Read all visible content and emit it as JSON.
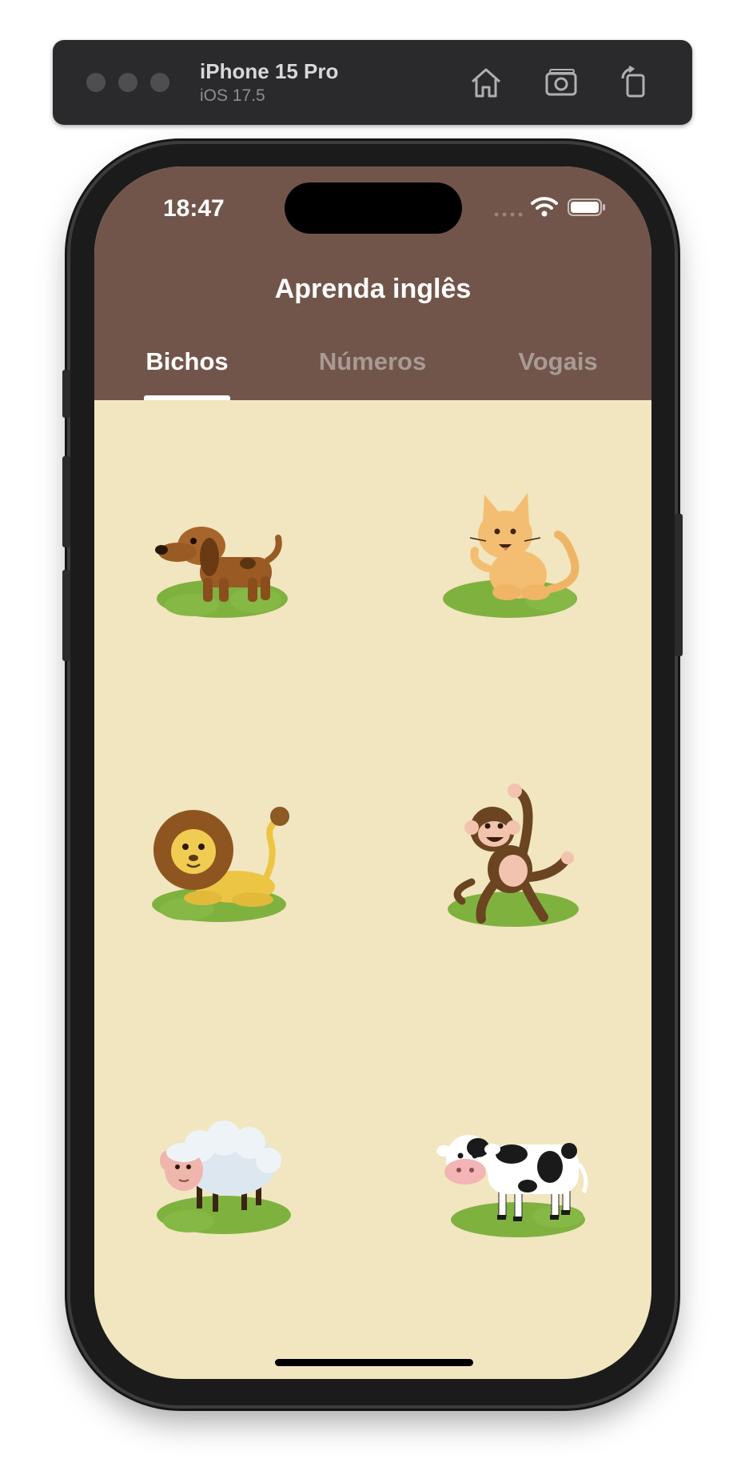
{
  "simulator": {
    "device_name": "iPhone 15 Pro",
    "os_version": "iOS 17.5"
  },
  "status_bar": {
    "time": "18:47"
  },
  "app": {
    "title": "Aprenda inglês",
    "tabs": [
      {
        "label": "Bichos",
        "active": true
      },
      {
        "label": "Números",
        "active": false
      },
      {
        "label": "Vogais",
        "active": false
      }
    ],
    "colors": {
      "appbar": "#72554a",
      "background": "#f1e6bf",
      "inactive_tab": "#a89a94"
    },
    "animals": [
      {
        "icon": "dog-icon"
      },
      {
        "icon": "cat-icon"
      },
      {
        "icon": "lion-icon"
      },
      {
        "icon": "monkey-icon"
      },
      {
        "icon": "sheep-icon"
      },
      {
        "icon": "cow-icon"
      }
    ]
  }
}
